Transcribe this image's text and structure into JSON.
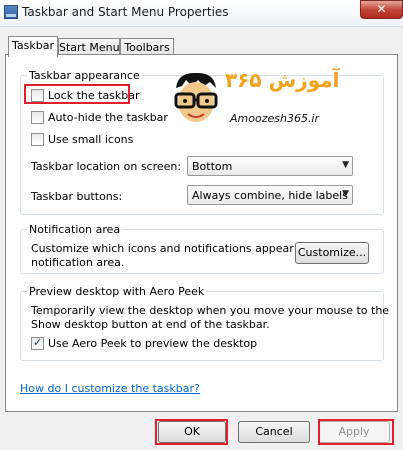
{
  "window": {
    "title": "Taskbar and Start Menu Properties",
    "close_glyph": "✕"
  },
  "tabs": [
    {
      "label": "Taskbar",
      "active": true
    },
    {
      "label": "Start Menu",
      "active": false
    },
    {
      "label": "Toolbars",
      "active": false
    }
  ],
  "taskbar_appearance": {
    "group_title": "Taskbar appearance",
    "lock_taskbar": {
      "label": "Lock the taskbar",
      "checked": false
    },
    "auto_hide": {
      "label": "Auto-hide the taskbar",
      "checked": false
    },
    "small_icons": {
      "label": "Use small icons",
      "checked": false
    },
    "location_label": "Taskbar location on screen:",
    "location_value": "Bottom",
    "buttons_label": "Taskbar buttons:",
    "buttons_value": "Always combine, hide labels"
  },
  "notification_area": {
    "group_title": "Notification area",
    "description_line1": "Customize which icons and notifications appear in the",
    "description_line2": "notification area.",
    "customize_button": "Customize..."
  },
  "aero_peek": {
    "group_title": "Preview desktop with Aero Peek",
    "description_line1": "Temporarily view the desktop when you move your mouse to the",
    "description_line2": "Show desktop button at end of the taskbar.",
    "use_aero_peek": {
      "label": "Use Aero Peek to preview the desktop",
      "checked": true
    }
  },
  "help_link": "How do I customize the taskbar?",
  "footer": {
    "ok": "OK",
    "cancel": "Cancel",
    "apply": "Apply"
  },
  "watermark": {
    "persian_text": "آموزش ۳۶۵",
    "url": "Amoozesh365.ir"
  },
  "colors": {
    "highlight": "#e0202a",
    "link": "#0066cc",
    "watermark_orange": "#f3a21b"
  }
}
